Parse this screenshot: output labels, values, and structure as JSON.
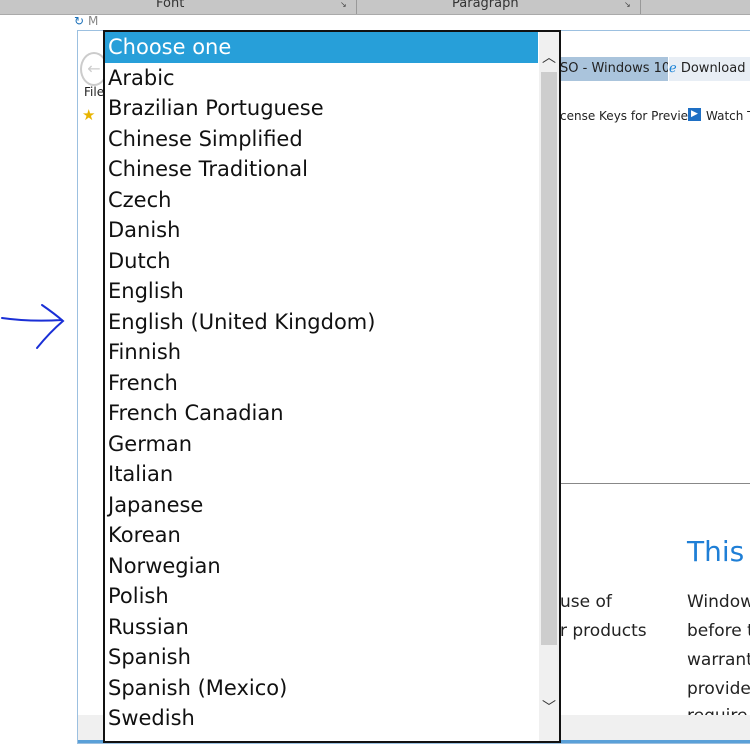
{
  "ribbon": {
    "groups": [
      "Font",
      "Paragraph"
    ]
  },
  "taskbar_fragment": "M",
  "browser": {
    "tabs": [
      "SO - Windows 10 ...",
      "Download"
    ],
    "menu_file": "File",
    "favorites": [
      "cense Keys for Previe...",
      "Watch T"
    ],
    "content": {
      "heading": "This i",
      "left_lines": [
        "use of",
        "r products"
      ],
      "right_lines": [
        "Window",
        "before t",
        "warrant",
        "provide",
        "require"
      ]
    }
  },
  "dropdown": {
    "selected": "Choose one",
    "options": [
      "Choose one",
      "Arabic",
      "Brazilian Portuguese",
      "Chinese Simplified",
      "Chinese Traditional",
      "Czech",
      "Danish",
      "Dutch",
      "English",
      "English (United Kingdom)",
      "Finnish",
      "French",
      "French Canadian",
      "German",
      "Italian",
      "Japanese",
      "Korean",
      "Norwegian",
      "Polish",
      "Russian",
      "Spanish",
      "Spanish (Mexico)",
      "Swedish"
    ],
    "highlight_color": "#279fd9"
  },
  "annotation": {
    "arrow_color": "#1a2fd6"
  }
}
